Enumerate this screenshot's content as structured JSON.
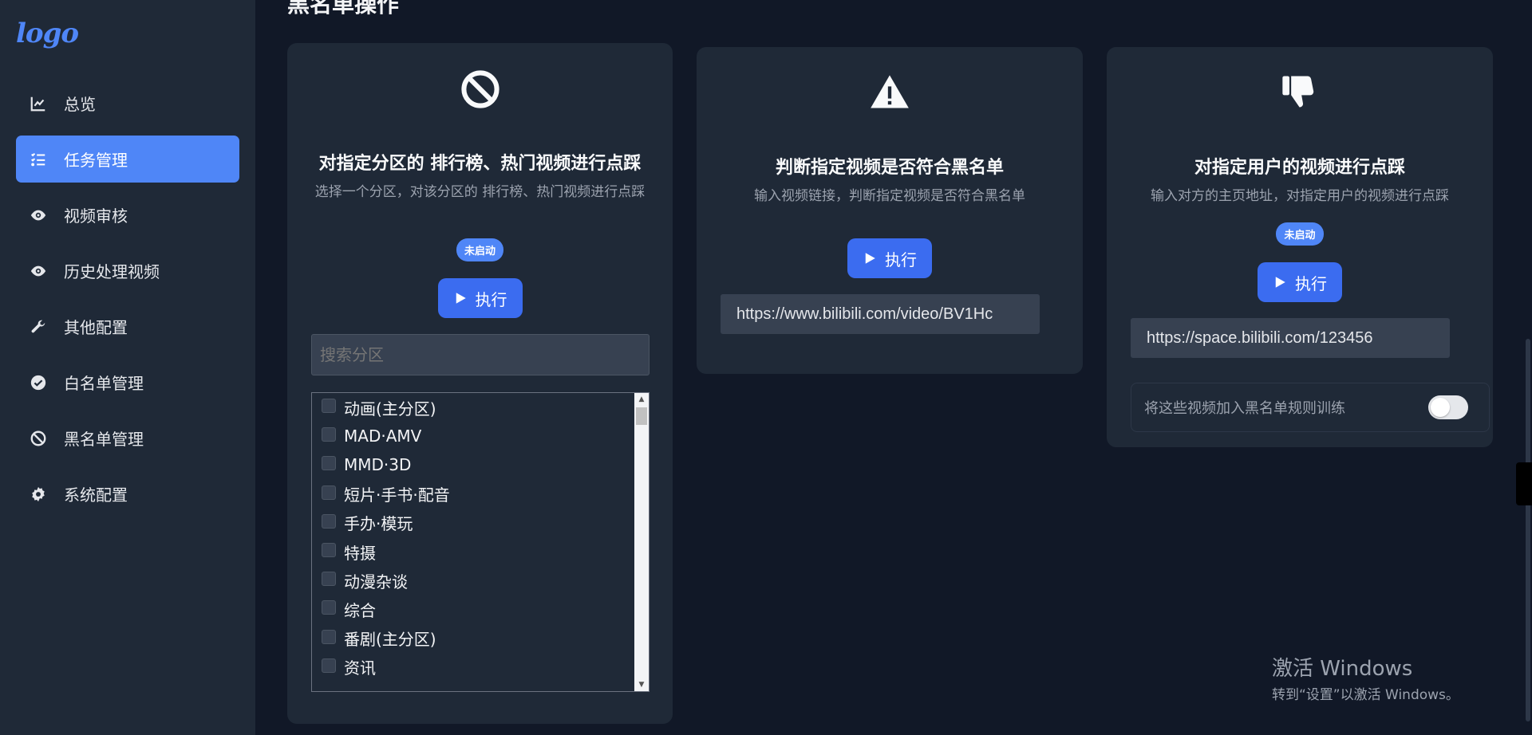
{
  "sidebar": {
    "logo": "logo",
    "items": [
      {
        "label": "总览",
        "icon": "chart-line-icon",
        "active": false
      },
      {
        "label": "任务管理",
        "icon": "task-list-icon",
        "active": true
      },
      {
        "label": "视频审核",
        "icon": "eye-icon",
        "active": false
      },
      {
        "label": "历史处理视频",
        "icon": "eye-icon",
        "active": false
      },
      {
        "label": "其他配置",
        "icon": "wrench-icon",
        "active": false
      },
      {
        "label": "白名单管理",
        "icon": "check-circle-icon",
        "active": false
      },
      {
        "label": "黑名单管理",
        "icon": "ban-icon",
        "active": false
      },
      {
        "label": "系统配置",
        "icon": "gear-icon",
        "active": false
      }
    ]
  },
  "main": {
    "section_title": "黑名单操作",
    "cards": [
      {
        "title": "对指定分区的 排行榜、热门视频进行点踩",
        "desc": "选择一个分区，对该分区的 排行榜、热门视频进行点踩",
        "badge": "未启动",
        "button": "执行",
        "search_placeholder": "搜索分区",
        "categories": [
          "动画(主分区)",
          "MAD·AMV",
          "MMD·3D",
          "短片·手书·配音",
          "手办·模玩",
          "特摄",
          "动漫杂谈",
          "综合",
          "番剧(主分区)",
          "资讯"
        ]
      },
      {
        "title": "判断指定视频是否符合黑名单",
        "desc": "输入视频链接，判断指定视频是否符合黑名单",
        "button": "执行",
        "input_value": "https://www.bilibili.com/video/BV1Hc"
      },
      {
        "title": "对指定用户的视频进行点踩",
        "desc": "输入对方的主页地址，对指定用户的视频进行点踩",
        "badge": "未启动",
        "button": "执行",
        "input_value": "https://space.bilibili.com/123456",
        "toggle_label": "将这些视频加入黑名单规则训练",
        "toggle_on": false
      }
    ]
  },
  "windows_watermark": {
    "line1": "激活 Windows",
    "line2": "转到“设置”以激活 Windows。"
  },
  "colors": {
    "accent": "#4f86f7",
    "button": "#3b6cf0",
    "sidebar_bg": "#1f2937",
    "page_bg": "#111827"
  }
}
